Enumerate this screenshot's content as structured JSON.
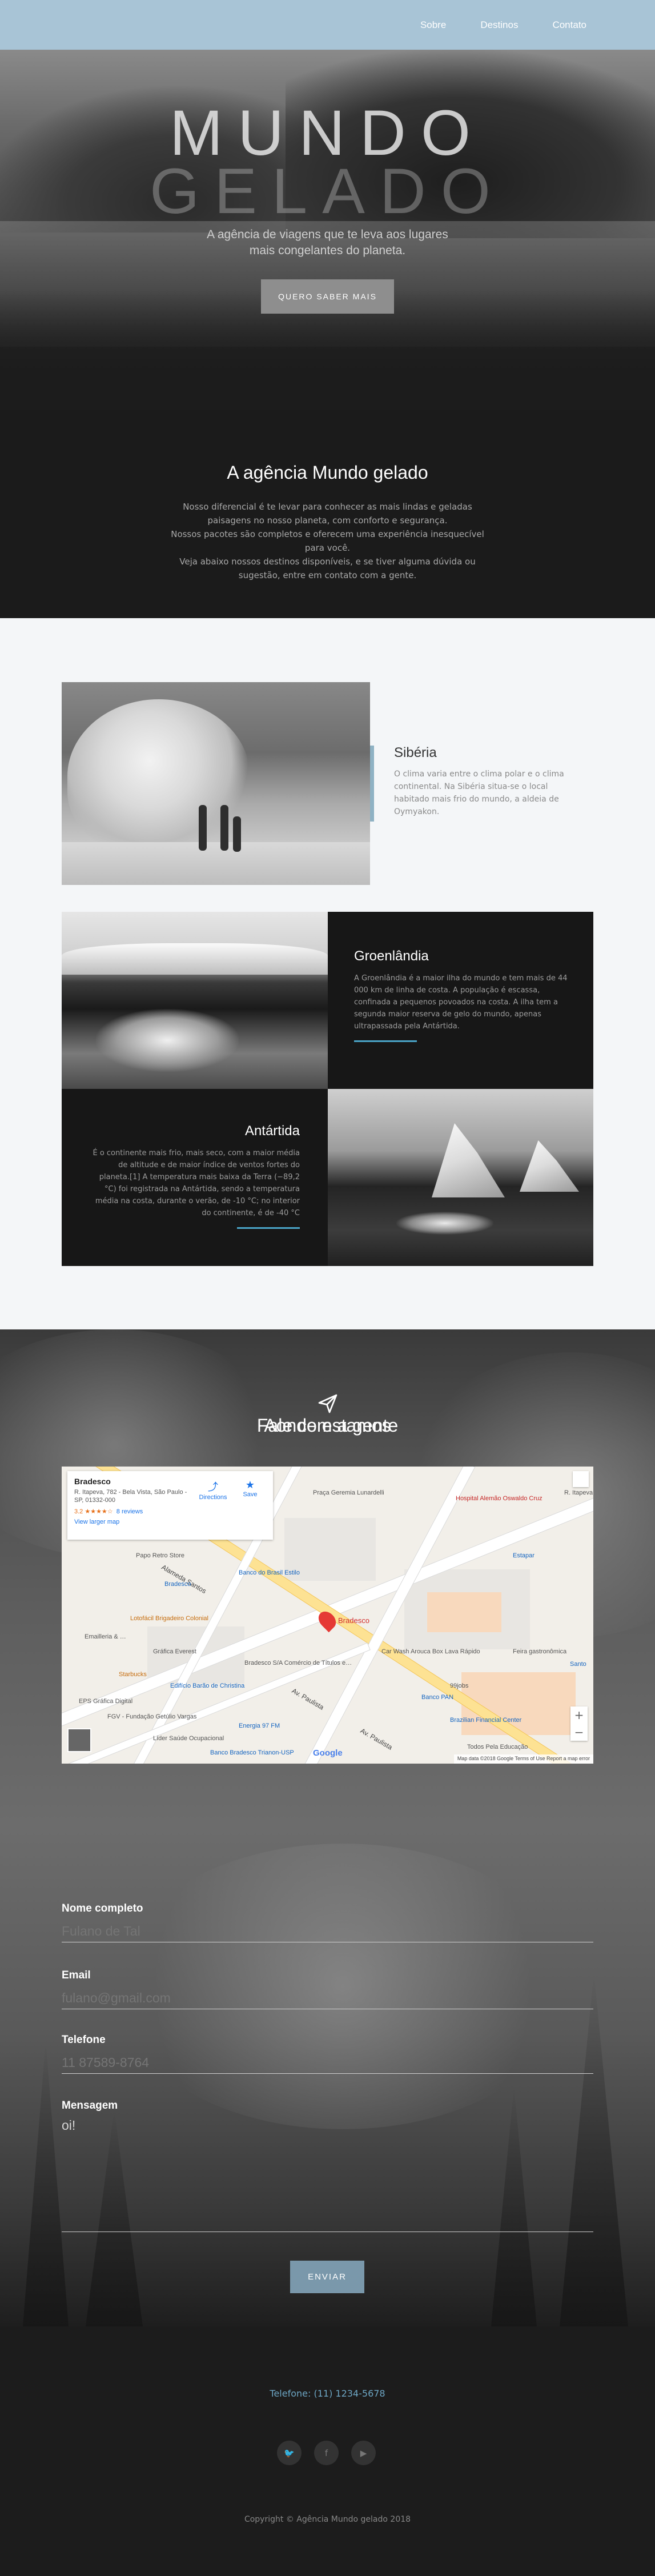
{
  "nav": {
    "items": [
      "Sobre",
      "Destinos",
      "Contato"
    ]
  },
  "hero": {
    "title_line1": "MUNDO",
    "title_line2": "GELADO",
    "subtitle_line1": "A agência de viagens que te leva aos lugares",
    "subtitle_line2": "mais congelantes do planeta.",
    "button": "QUERO SABER MAIS"
  },
  "agency": {
    "title": "A agência Mundo gelado",
    "lines": [
      "Nosso diferencial é te levar para conhecer as mais lindas e geladas",
      "paisagens no nosso planeta, com conforto e segurança.",
      "Nossos pacotes são completos e oferecem uma experiência inesquecível",
      "para você.",
      "Veja abaixo nossos destinos disponíveis, e se tiver alguma dúvida ou",
      "sugestão, entre em contato com a gente."
    ]
  },
  "destinations": {
    "siberia": {
      "title": "Sibéria",
      "text": "O clima varia entre o clima polar e o clima continental. Na Sibéria situa-se o local habitado mais frio do mundo, a aldeia de Oymyakon."
    },
    "greenland": {
      "title": "Groenlândia",
      "text": "A Groenlândia é a maior ilha do mundo e tem mais de 44 000 km de linha de costa. A população é escassa, confinada a pequenos povoados na costa. A ilha tem a segunda maior reserva de gelo do mundo, apenas ultrapassada pela Antártida."
    },
    "antarctica": {
      "title": "Antártida",
      "text": "É o continente mais frio, mais seco, com a maior média de altitude e de maior índice de ventos fortes do planeta.[1] A temperatura mais baixa da Terra (−89,2 °C) foi registrada na Antártida, sendo a temperatura média na costa, durante o verão, de -10 °C; no interior do continente, é de -40 °C"
    }
  },
  "location": {
    "title": "Aonde estamos",
    "map": {
      "place_name": "Bradesco",
      "address": "R. Itapeva, 782 - Bela Vista, São Paulo - SP, 01332-000",
      "rating": "3.2 ★★★★☆",
      "reviews": "8 reviews",
      "larger_map": "View larger map",
      "directions": "Directions",
      "save": "Save",
      "pin_label": "Bradesco",
      "footer": "Map data ©2018 Google   Terms of Use   Report a map error",
      "google": "Google",
      "zoom_in": "+",
      "zoom_out": "−",
      "labels": {
        "l1": "Praça Geremia Lunardelli",
        "l2": "Hospital Alemão Oswaldo Cruz",
        "l3": "R. Itapeva",
        "l4": "Estapar",
        "l5": "Papo Retro Store",
        "l6": "Banco do Brasil Estilo",
        "l7": "Alameda Santos",
        "l8": "Bradesco",
        "l9": "Lotofácil Brigadeiro Colonial",
        "l10": "Emailleria & …",
        "l11": "Gráfica Everest",
        "l12": "Bradesco S/A Comércio de Títulos e…",
        "l13": "Car Wash Arouca Box Lava Rápido",
        "l14": "Feira gastronômica",
        "l15": "Starbucks",
        "l16": "Edifício Barão de Christina",
        "l17": "99jobs",
        "l18": "Banco PAN",
        "l19": "EPS Gráfica Digital",
        "l20": "Av. Paulista",
        "l21": "FGV - Fundação Getúlio Vargas",
        "l22": "Energia 97 FM",
        "l23": "Brazilian Financial Center",
        "l24": "Líder Saúde Ocupacional",
        "l25": "Banco Bradesco Trianon-USP",
        "l26": "Todos Pela Educação",
        "l27": "Av. Paulista",
        "l28": "Santo"
      }
    }
  },
  "contact": {
    "title": "Fale com a gente",
    "name_label": "Nome completo",
    "name_placeholder": "Fulano de Tal",
    "email_label": "Email",
    "email_placeholder": "fulano@gmail.com",
    "phone_label": "Telefone",
    "phone_placeholder": "11 87589-8764",
    "message_label": "Mensagem",
    "message_value": "oi!",
    "send": "ENVIAR"
  },
  "footer": {
    "phone": "Telefone: (11) 1234-5678",
    "social_icons": [
      "twitter-icon",
      "facebook-icon",
      "youtube-icon"
    ],
    "social_glyphs": [
      "🐦",
      "f",
      "▶"
    ],
    "copyright": "Copyright © Agência Mundo gelado 2018"
  },
  "colors": {
    "nav": "#a8c4d6",
    "accent": "#4aa3c6",
    "button": "#7a98ab"
  }
}
